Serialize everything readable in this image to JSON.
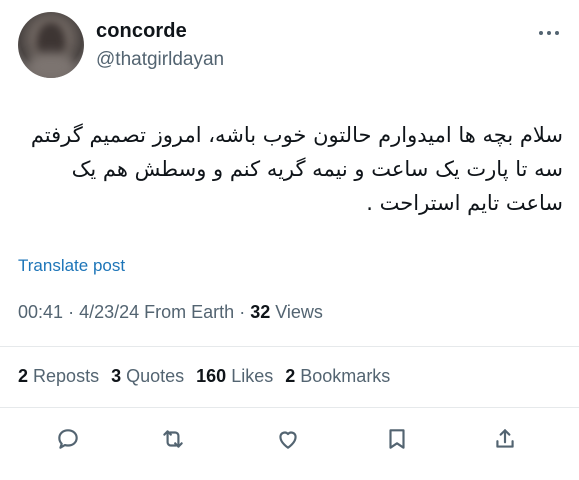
{
  "author": {
    "display_name": "concorde",
    "handle": "@thatgirldayan"
  },
  "tweet": {
    "text": "سلام بچه ها امیدوارم حالتون خوب باشه، امروز تصمیم گرفتم سه تا پارت یک ساعت و نیمه گریه کنم و وسطش هم یک ساعت تایم استراحت ."
  },
  "translate_label": "Translate post",
  "meta": {
    "time": "00:41",
    "date": "4/23/24",
    "source": "From Earth",
    "views_count": "32",
    "views_label": "Views"
  },
  "stats": {
    "reposts_count": "2",
    "reposts_label": "Reposts",
    "quotes_count": "3",
    "quotes_label": "Quotes",
    "likes_count": "160",
    "likes_label": "Likes",
    "bookmarks_count": "2",
    "bookmarks_label": "Bookmarks"
  },
  "actions": [
    "reply-icon",
    "repost-icon",
    "like-icon",
    "bookmark-icon",
    "share-icon"
  ],
  "colors": {
    "text": "#0f1419",
    "secondary": "#536471",
    "link": "#1d75b8",
    "divider": "#e6e9eb"
  }
}
